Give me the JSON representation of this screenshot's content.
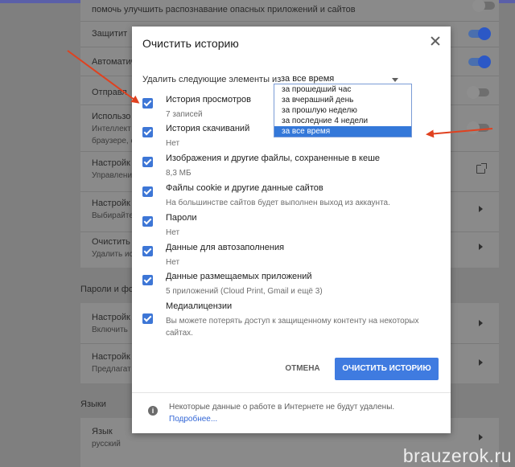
{
  "background": {
    "rows": [
      {
        "title": "помочь улучшить распознавание опасных приложений и сайтов",
        "sub": ""
      },
      {
        "title": "Защитит",
        "sub": ""
      },
      {
        "title": "Автоматич",
        "sub": ""
      },
      {
        "title": "Отправл",
        "sub": ""
      },
      {
        "title": "Использо",
        "sub": "Интеллект"
      },
      {
        "title": "",
        "sub": "браузере, с"
      },
      {
        "title": "Настройк",
        "sub": "Управлени"
      },
      {
        "title": "Настройк",
        "sub": "Выбирайте"
      },
      {
        "title": "Очистить",
        "sub": "Удалить ис"
      },
      {
        "title": "Настройк",
        "sub": "Включить"
      },
      {
        "title": "Настройк",
        "sub": "Предлагат"
      },
      {
        "title": "Язык",
        "sub": "русский"
      }
    ],
    "sections": {
      "passwords": "Пароли и фор",
      "languages": "Языки"
    }
  },
  "dialog": {
    "title": "Очистить историю",
    "period_label": "Удалить следующие элементы из",
    "period_value": "за все время",
    "period_options": [
      "за прошедший час",
      "за вчерашний день",
      "за прошлую неделю",
      "за последние 4 недели",
      "за все время"
    ],
    "items": [
      {
        "title": "История просмотров",
        "sub": "7 записей"
      },
      {
        "title": "История скачиваний",
        "sub": "Нет"
      },
      {
        "title": "Изображения и другие файлы, сохраненные в кеше",
        "sub": "8,3 МБ"
      },
      {
        "title": "Файлы cookie и другие данные сайтов",
        "sub": "На большинстве сайтов будет выполнен выход из аккаунта."
      },
      {
        "title": "Пароли",
        "sub": "Нет"
      },
      {
        "title": "Данные для автозаполнения",
        "sub": "Нет"
      },
      {
        "title": "Данные размещаемых приложений",
        "sub": "5 приложений (Cloud Print, Gmail и ещё 3)"
      },
      {
        "title": "Медиалицензии",
        "sub": "Вы можете потерять доступ к защищенному контенту на некоторых сайтах."
      }
    ],
    "cancel_label": "ОТМЕНА",
    "clear_label": "ОЧИСТИТЬ ИСТОРИЮ",
    "footer_text": "Некоторые данные о работе в Интернете не будут удалены.",
    "footer_link": "Подробнее..."
  },
  "watermark": "brauzerok.ru",
  "colors": {
    "accent": "#3f7be0",
    "checkbox": "#3d76d6",
    "selected_option": "#3478d9",
    "annotation_arrow": "#e0411f"
  }
}
